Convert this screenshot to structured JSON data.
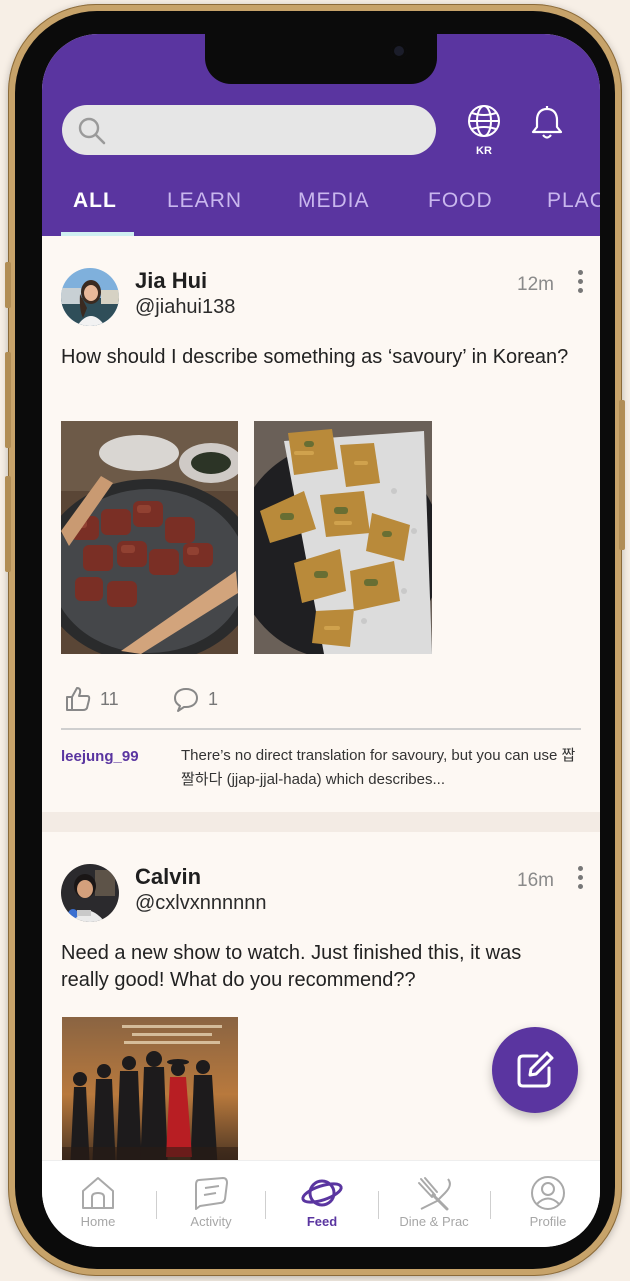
{
  "search": {
    "placeholder": ""
  },
  "language": {
    "label": "KR"
  },
  "tabs": [
    {
      "label": "ALL",
      "active": true
    },
    {
      "label": "LEARN"
    },
    {
      "label": "MEDIA"
    },
    {
      "label": "FOOD"
    },
    {
      "label": "PLAC"
    }
  ],
  "posts": [
    {
      "name": "Jia Hui",
      "handle": "@jiahui138",
      "time": "12m",
      "text": "How should I describe something as ‘savoury’ in Korean?",
      "likes": "11",
      "comments": "1",
      "reply": {
        "user": "leejung_99",
        "text": "There’s no direct translation for savoury, but you can use 짭짤하다 (jjap-jjal-hada) which describes..."
      }
    },
    {
      "name": "Calvin",
      "handle": "@cxlvxnnnnnn",
      "time": "16m",
      "text": "Need a new show to watch. Just finished this, it was really good! What do you recommend??"
    }
  ],
  "nav": [
    {
      "label": "Home",
      "icon": "home-icon"
    },
    {
      "label": "Activity",
      "icon": "activity-icon"
    },
    {
      "label": "Feed",
      "icon": "planet-icon",
      "active": true
    },
    {
      "label": "Dine & Prac",
      "icon": "fork-knife-icon"
    },
    {
      "label": "Profile",
      "icon": "profile-icon"
    }
  ],
  "colors": {
    "brand": "#5a35a0",
    "accent_underline": "#cfeff1",
    "background": "#fdf8f3"
  }
}
